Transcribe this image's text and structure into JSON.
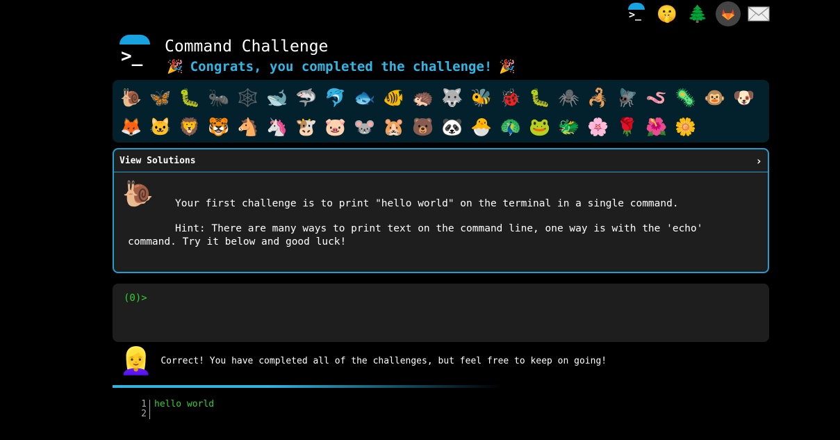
{
  "top_icons": [
    {
      "name": "command-challenge-icon",
      "glyph": ">_"
    },
    {
      "name": "shush-face-icon",
      "glyph": "🤫"
    },
    {
      "name": "tree-icon",
      "glyph": "🌲"
    },
    {
      "name": "gitlab-icon",
      "glyph": ""
    },
    {
      "name": "mail-icon",
      "glyph": ""
    }
  ],
  "header": {
    "logo_glyph": ">_",
    "title": "Command Challenge",
    "congrats": "Congrats, you completed the challenge!",
    "party_glyph": "🎉"
  },
  "animals": [
    "🐌",
    "🦋",
    "🐛",
    "🐜",
    "🕸️",
    "🐋",
    "🦈",
    "🐬",
    "🐟",
    "🐠",
    "🦔",
    "🐺",
    "🐝",
    "🐞",
    "🐛",
    "🕷️",
    "🦂",
    "🪰",
    "🪱",
    "🦠",
    "🐵",
    "🐶",
    "🦊",
    "🐱",
    "🦁",
    "🐯",
    "🐴",
    "🦄",
    "🐮",
    "🐷",
    "🐭",
    "🐹",
    "🐻",
    "🐼",
    "🐣",
    "🦚",
    "🐸",
    "🐲",
    "🌸",
    "🌹",
    "🌺",
    "🌼"
  ],
  "challenge": {
    "solutions_label": "View Solutions",
    "chevron": "›",
    "icon": "🐌",
    "text": "Your first challenge is to print \"hello world\" on the terminal in a single command.",
    "hint": "Hint: There are many ways to print text on the command line, one way is with the 'echo' command. Try it below and good luck!"
  },
  "terminal": {
    "prompt": "(0)>"
  },
  "result": {
    "avatar": "👱‍♀️",
    "message": "Correct! You have completed all of the challenges, but feel free to keep on going!"
  },
  "editor": {
    "line_numbers": [
      "1",
      "2"
    ],
    "lines": [
      "hello world",
      ""
    ]
  },
  "colors": {
    "accent": "#1f9fcf",
    "prompt_green": "#2fd12f",
    "congrats_blue": "#2eb8e6"
  }
}
